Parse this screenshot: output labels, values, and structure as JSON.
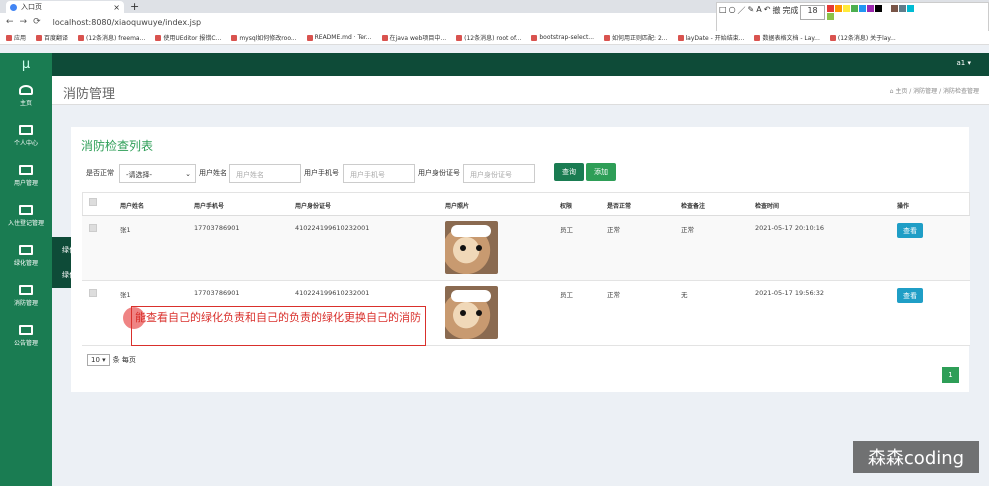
{
  "browser": {
    "tab_title": "入口页",
    "url": "localhost:8080/xiaoquwuye/index.jsp",
    "bookmarks": [
      "应用",
      "百度翻译",
      "(12条消息) freema...",
      "使用UEditor 报错C...",
      "mysql如何修改roo...",
      "README.md · Ter...",
      "在java web项目中...",
      "(12条消息) root of...",
      "bootstrap-select...",
      "如何用正则匹配: 2...",
      "layDate - 开始结束...",
      "数据表格文档 - Lay...",
      "(12条消息) 关于lay..."
    ],
    "toolbar_items": [
      "A",
      "18",
      "撤",
      "完成"
    ],
    "palette": [
      "#e53935",
      "#ff9800",
      "#ffeb3b",
      "#4caf50",
      "#2196f3",
      "#9c27b0",
      "#000000",
      "#ffffff",
      "#795548",
      "#607d8b",
      "#00bcd4",
      "#8bc34a"
    ]
  },
  "app": {
    "logo": "μ",
    "user": "a1 ▾",
    "sidebar": [
      {
        "label": "主页",
        "icon": "dashboard-icon"
      },
      {
        "label": "个人中心",
        "icon": "monitor-icon"
      },
      {
        "label": "用户管理",
        "icon": "monitor-icon"
      },
      {
        "label": "入住登记管理",
        "icon": "monitor-icon"
      },
      {
        "label": "绿化管理",
        "icon": "monitor-icon"
      },
      {
        "label": "消防管理",
        "icon": "monitor-icon"
      },
      {
        "label": "公告管理",
        "icon": "monitor-icon"
      }
    ],
    "submenu": [
      "绿化负责管理",
      "绿化更换管理"
    ],
    "page_title": "消防管理",
    "breadcrumb": "⌂ 主页 / 消防管理 / 消防检查管理",
    "list_title": "消防检查列表",
    "filters": {
      "normal_label": "是否正常",
      "normal_value": "-请选择-",
      "name_label": "用户姓名",
      "name_ph": "用户姓名",
      "phone_label": "用户手机号",
      "phone_ph": "用户手机号",
      "id_label": "用户身份证号",
      "id_ph": "用户身份证号",
      "query": "查询",
      "add": "添加"
    },
    "columns": [
      "用户姓名",
      "用户手机号",
      "用户身份证号",
      "用户照片",
      "权限",
      "是否正常",
      "检查备注",
      "检查时间",
      "操作"
    ],
    "rows": [
      {
        "name": "张1",
        "phone": "17703786901",
        "idno": "410224199610232001",
        "role": "员工",
        "normal": "正常",
        "note": "正常",
        "time": "2021-05-17 20:10:16",
        "action": "查看"
      },
      {
        "name": "张1",
        "phone": "17703786901",
        "idno": "410224199610232001",
        "role": "员工",
        "normal": "正常",
        "note": "无",
        "time": "2021-05-17 19:56:32",
        "action": "查看"
      }
    ],
    "page_size": "10 ▾",
    "page_size_suffix": "条 每页",
    "page_num": "1"
  },
  "annotation": "能查看自己的绿化负责和自己的负责的绿化更换自己的消防",
  "watermark": "森森coding"
}
